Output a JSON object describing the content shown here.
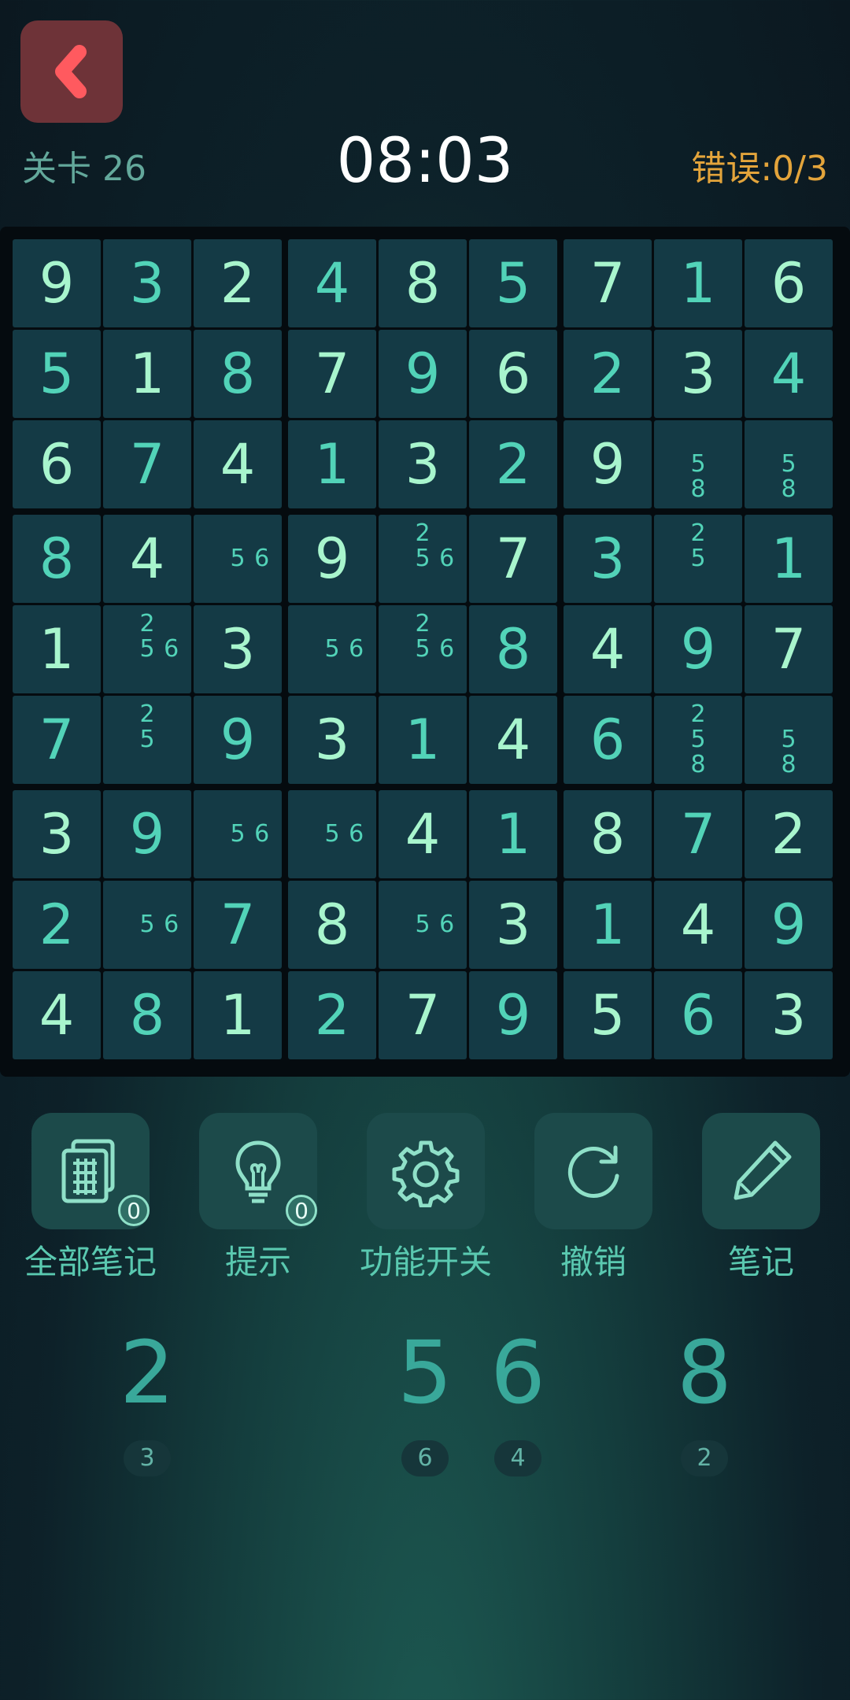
{
  "header": {
    "level": "关卡 26",
    "timer": "08:03",
    "errors": "错误:0/3"
  },
  "colors": {
    "back_button": "#6e3338",
    "back_chevron": "#ff5a5f",
    "fixed_digit": "#a8f5cd",
    "user_digit": "#52d3b8",
    "error_text": "#e3a43b"
  },
  "board": [
    [
      "9",
      "3",
      "2",
      "4",
      "8",
      "5",
      "7",
      "1",
      "6"
    ],
    [
      "5",
      "1",
      "8",
      "7",
      "9",
      "6",
      "2",
      "3",
      "4"
    ],
    [
      "6",
      "7",
      "4",
      "1",
      "3",
      "2",
      "9",
      [
        "5",
        "8"
      ],
      [
        "5",
        "8"
      ]
    ],
    [
      "8",
      "4",
      [
        "5",
        "6"
      ],
      "9",
      [
        "2",
        "5",
        "6"
      ],
      "7",
      "3",
      [
        "2",
        "5"
      ],
      "1"
    ],
    [
      "1",
      [
        "2",
        "5",
        "6"
      ],
      "3",
      [
        "5",
        "6"
      ],
      [
        "2",
        "5",
        "6"
      ],
      "8",
      "4",
      "9",
      "7"
    ],
    [
      "7",
      [
        "2",
        "5"
      ],
      "9",
      "3",
      "1",
      "4",
      "6",
      [
        "2",
        "5",
        "8"
      ],
      [
        "5",
        "8"
      ]
    ],
    [
      "3",
      "9",
      [
        "5",
        "6"
      ],
      [
        "5",
        "6"
      ],
      "4",
      "1",
      "8",
      "7",
      "2"
    ],
    [
      "2",
      [
        "5",
        "6"
      ],
      "7",
      "8",
      [
        "5",
        "6"
      ],
      "3",
      "1",
      "4",
      "9"
    ],
    [
      "4",
      "8",
      "1",
      "2",
      "7",
      "9",
      "5",
      "6",
      "3"
    ]
  ],
  "tools": [
    {
      "name": "all-notes",
      "label": "全部笔记",
      "icon": "notes-grid-icon",
      "badge": "0"
    },
    {
      "name": "hint",
      "label": "提示",
      "icon": "lightbulb-icon",
      "badge": "0"
    },
    {
      "name": "settings",
      "label": "功能开关",
      "icon": "gear-icon"
    },
    {
      "name": "undo",
      "label": "撤销",
      "icon": "undo-icon"
    },
    {
      "name": "notes",
      "label": "笔记",
      "icon": "pencil-icon"
    }
  ],
  "digits": [
    {
      "digit": "2",
      "remaining": "3"
    },
    {
      "digit": "5",
      "remaining": "6"
    },
    {
      "digit": "6",
      "remaining": "4"
    },
    {
      "digit": "8",
      "remaining": "2"
    }
  ]
}
